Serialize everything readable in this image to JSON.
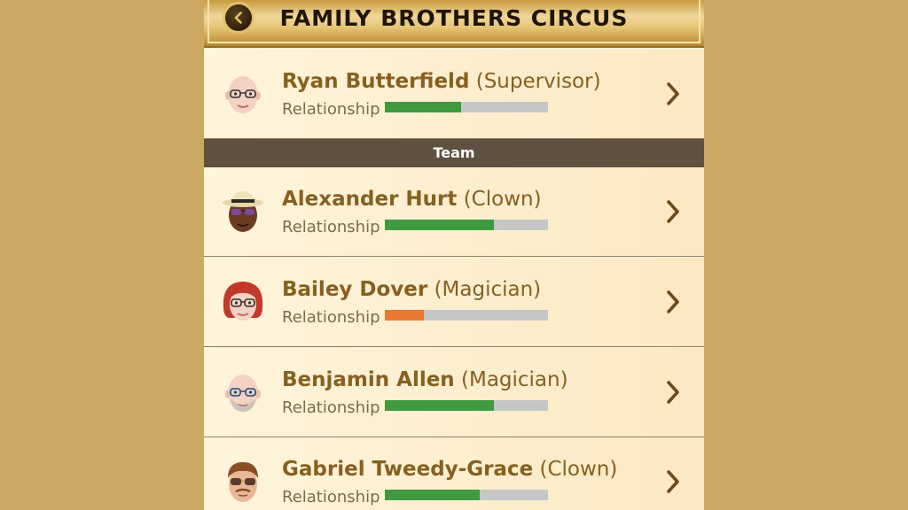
{
  "header": {
    "title": "FAMILY BROTHERS CIRCUS"
  },
  "supervisor": {
    "name": "Ryan Butterfield",
    "role": "(Supervisor)",
    "relationship_label": "Relationship",
    "relationship": 0.47,
    "bar_color": "#3f9a40"
  },
  "section": {
    "label": "Team"
  },
  "team": [
    {
      "name": "Alexander Hurt",
      "role": "(Clown)",
      "relationship_label": "Relationship",
      "relationship": 0.67,
      "bar_color": "#3f9a40"
    },
    {
      "name": "Bailey Dover",
      "role": "(Magician)",
      "relationship_label": "Relationship",
      "relationship": 0.24,
      "bar_color": "#e97a2f"
    },
    {
      "name": "Benjamin Allen",
      "role": "(Magician)",
      "relationship_label": "Relationship",
      "relationship": 0.67,
      "bar_color": "#3f9a40"
    },
    {
      "name": "Gabriel Tweedy-Grace",
      "role": "(Clown)",
      "relationship_label": "Relationship",
      "relationship": 0.58,
      "bar_color": "#3f9a40"
    }
  ],
  "icons": {
    "back": "chevron-left-icon",
    "row_action": "chevron-right-icon"
  }
}
